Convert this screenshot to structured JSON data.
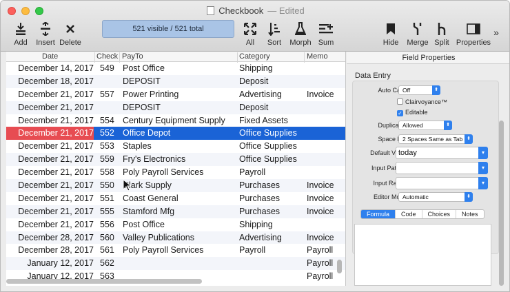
{
  "window": {
    "title": "Checkbook",
    "edited": "— Edited"
  },
  "toolbar": {
    "add": "Add",
    "insert": "Insert",
    "delete": "Delete",
    "status": "521 visible / 521 total",
    "all": "All",
    "sort": "Sort",
    "morph": "Morph",
    "sum": "Sum",
    "hide": "Hide",
    "merge": "Merge",
    "split": "Split",
    "properties": "Properties",
    "overflow": "»"
  },
  "columns": {
    "date": "Date",
    "check": "Check",
    "payto": "PayTo",
    "category": "Category",
    "memo": "Memo"
  },
  "rows": [
    {
      "date": "December 14, 2017",
      "check": "549",
      "payto": "Post Office",
      "category": "Shipping",
      "memo": ""
    },
    {
      "date": "December 18, 2017",
      "check": "",
      "payto": "DEPOSIT",
      "category": "Deposit",
      "memo": ""
    },
    {
      "date": "December 21, 2017",
      "check": "557",
      "payto": "Power Printing",
      "category": "Advertising",
      "memo": "Invoice"
    },
    {
      "date": "December 21, 2017",
      "check": "",
      "payto": "DEPOSIT",
      "category": "Deposit",
      "memo": ""
    },
    {
      "date": "December 21, 2017",
      "check": "554",
      "payto": "Century Equipment Supply",
      "category": "Fixed Assets",
      "memo": ""
    },
    {
      "date": "December 21, 2017",
      "check": "552",
      "payto": "Office Depot",
      "category": "Office Supplies",
      "memo": "",
      "selected": true
    },
    {
      "date": "December 21, 2017",
      "check": "553",
      "payto": "Staples",
      "category": "Office Supplies",
      "memo": ""
    },
    {
      "date": "December 21, 2017",
      "check": "559",
      "payto": "Fry's Electronics",
      "category": "Office Supplies",
      "memo": ""
    },
    {
      "date": "December 21, 2017",
      "check": "558",
      "payto": "Poly Payroll Services",
      "category": "Payroll",
      "memo": ""
    },
    {
      "date": "December 21, 2017",
      "check": "550",
      "payto": "Clark Supply",
      "category": "Purchases",
      "memo": "Invoice"
    },
    {
      "date": "December 21, 2017",
      "check": "551",
      "payto": "Coast General",
      "category": "Purchases",
      "memo": "Invoice"
    },
    {
      "date": "December 21, 2017",
      "check": "555",
      "payto": "Stamford Mfg",
      "category": "Purchases",
      "memo": "Invoice"
    },
    {
      "date": "December 21, 2017",
      "check": "556",
      "payto": "Post Office",
      "category": "Shipping",
      "memo": ""
    },
    {
      "date": "December 28, 2017",
      "check": "560",
      "payto": "Valley Publications",
      "category": "Advertising",
      "memo": "Invoice"
    },
    {
      "date": "December 28, 2017",
      "check": "561",
      "payto": "Poly Payroll Services",
      "category": "Payroll",
      "memo": "Payroll"
    },
    {
      "date": "January 12, 2017",
      "check": "562",
      "payto": "",
      "category": "",
      "memo": "Payroll"
    },
    {
      "date": "January 12, 2017",
      "check": "563",
      "payto": "",
      "category": "",
      "memo": "Payroll"
    }
  ],
  "properties": {
    "header": "Field Properties",
    "section": "Data Entry",
    "auto_caps_label": "Auto Caps:",
    "auto_caps_value": "Off",
    "clairvoyance": "Clairvoyance™",
    "clairvoyance_checked": false,
    "editable": "Editable",
    "editable_checked": true,
    "duplicates_label": "Duplicates:",
    "duplicates_value": "Allowed",
    "spacebar_label": "Space Bar:",
    "spacebar_value": "2 Spaces Same as Tab",
    "default_label": "Default Value:",
    "default_value": "today",
    "pattern_label": "Input Pattern:",
    "pattern_value": "",
    "range_label": "Input Range:",
    "range_value": "",
    "editor_label": "Editor Mode:",
    "editor_value": "Automatic",
    "tabs": [
      "Formula",
      "Code",
      "Choices",
      "Notes"
    ],
    "active_tab": "Formula"
  }
}
